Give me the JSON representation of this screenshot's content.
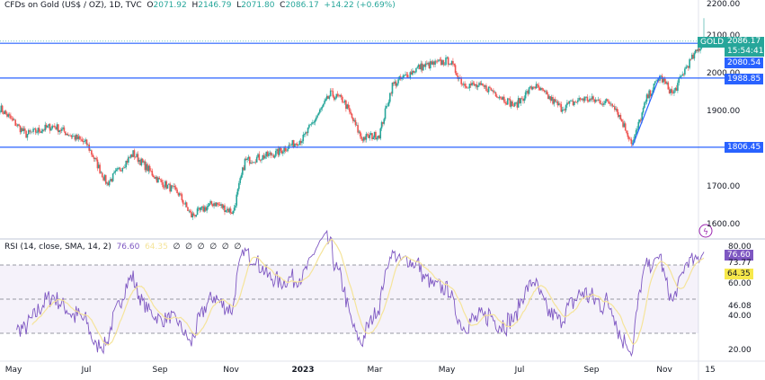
{
  "header": {
    "title": "CFDs on Gold (US$ / OZ), 1D, TVC",
    "open_label": "O",
    "open": "2071.92",
    "high_label": "H",
    "high": "2146.79",
    "low_label": "L",
    "low": "2071.80",
    "close_label": "C",
    "close": "2086.17",
    "change": "+14.22 (+0.69%)"
  },
  "price_axis": {
    "ticks": [
      "2200.00",
      "2100.00",
      "2000.00",
      "1900.00",
      "1700.00",
      "1600.00"
    ],
    "symbol_tag": "GOLD",
    "last_price": "2086.17",
    "countdown": "15:54:41",
    "levels": [
      "2080.54",
      "1988.85",
      "1806.45"
    ]
  },
  "rsi": {
    "label": "RSI (14, close, SMA, 14, 2)",
    "value": "76.60",
    "sma": "64.35",
    "hidden": [
      "∅",
      "∅",
      "∅",
      "∅",
      "∅",
      "∅"
    ],
    "axis": [
      "80.00",
      "73.77",
      "60.00",
      "46.08",
      "40.00",
      "20.00"
    ]
  },
  "x_axis": [
    "May",
    "Jul",
    "Sep",
    "Nov",
    "2023",
    "Mar",
    "May",
    "Jul",
    "Sep",
    "Nov",
    "15"
  ],
  "colors": {
    "up": "#26a69a",
    "down": "#ef5350",
    "level": "#2962ff",
    "rsi": "#7e57c2",
    "sma": "#f5e49a"
  },
  "chart_data": {
    "type": "candlestick",
    "title": "CFDs on Gold (US$ / OZ), 1D, TVC",
    "ylim": [
      1560,
      2200
    ],
    "horizontal_levels": [
      2080.54,
      1988.85,
      1806.45
    ],
    "trendline": [
      [
        "2023-10-05",
        1810
      ],
      [
        "2023-10-28",
        1995
      ]
    ],
    "close_path": [
      [
        "2022-04-21",
        1910
      ],
      [
        "2022-05-13",
        1840
      ],
      [
        "2022-06-05",
        1863
      ],
      [
        "2022-07-03",
        1815
      ],
      [
        "2022-07-20",
        1710
      ],
      [
        "2022-08-11",
        1790
      ],
      [
        "2022-09-01",
        1720
      ],
      [
        "2022-09-18",
        1685
      ],
      [
        "2022-09-29",
        1625
      ],
      [
        "2022-10-18",
        1660
      ],
      [
        "2022-11-03",
        1635
      ],
      [
        "2022-11-13",
        1770
      ],
      [
        "2022-12-09",
        1790
      ],
      [
        "2023-01-01",
        1830
      ],
      [
        "2023-01-24",
        1946
      ],
      [
        "2023-02-04",
        1930
      ],
      [
        "2023-02-19",
        1830
      ],
      [
        "2023-03-06",
        1840
      ],
      [
        "2023-03-17",
        1970
      ],
      [
        "2023-04-08",
        2017
      ],
      [
        "2023-05-04",
        2035
      ],
      [
        "2023-05-15",
        1975
      ],
      [
        "2023-06-07",
        1960
      ],
      [
        "2023-06-28",
        1915
      ],
      [
        "2023-07-14",
        1970
      ],
      [
        "2023-08-06",
        1910
      ],
      [
        "2023-08-24",
        1935
      ],
      [
        "2023-09-19",
        1922
      ],
      [
        "2023-10-05",
        1815
      ],
      [
        "2023-10-17",
        1935
      ],
      [
        "2023-10-28",
        1993
      ],
      [
        "2023-11-08",
        1946
      ],
      [
        "2023-11-19",
        2017
      ],
      [
        "2023-12-04",
        2086
      ]
    ],
    "rsi_levels": [
      70,
      50,
      30
    ],
    "rsi_ylim": [
      15,
      85
    ]
  }
}
